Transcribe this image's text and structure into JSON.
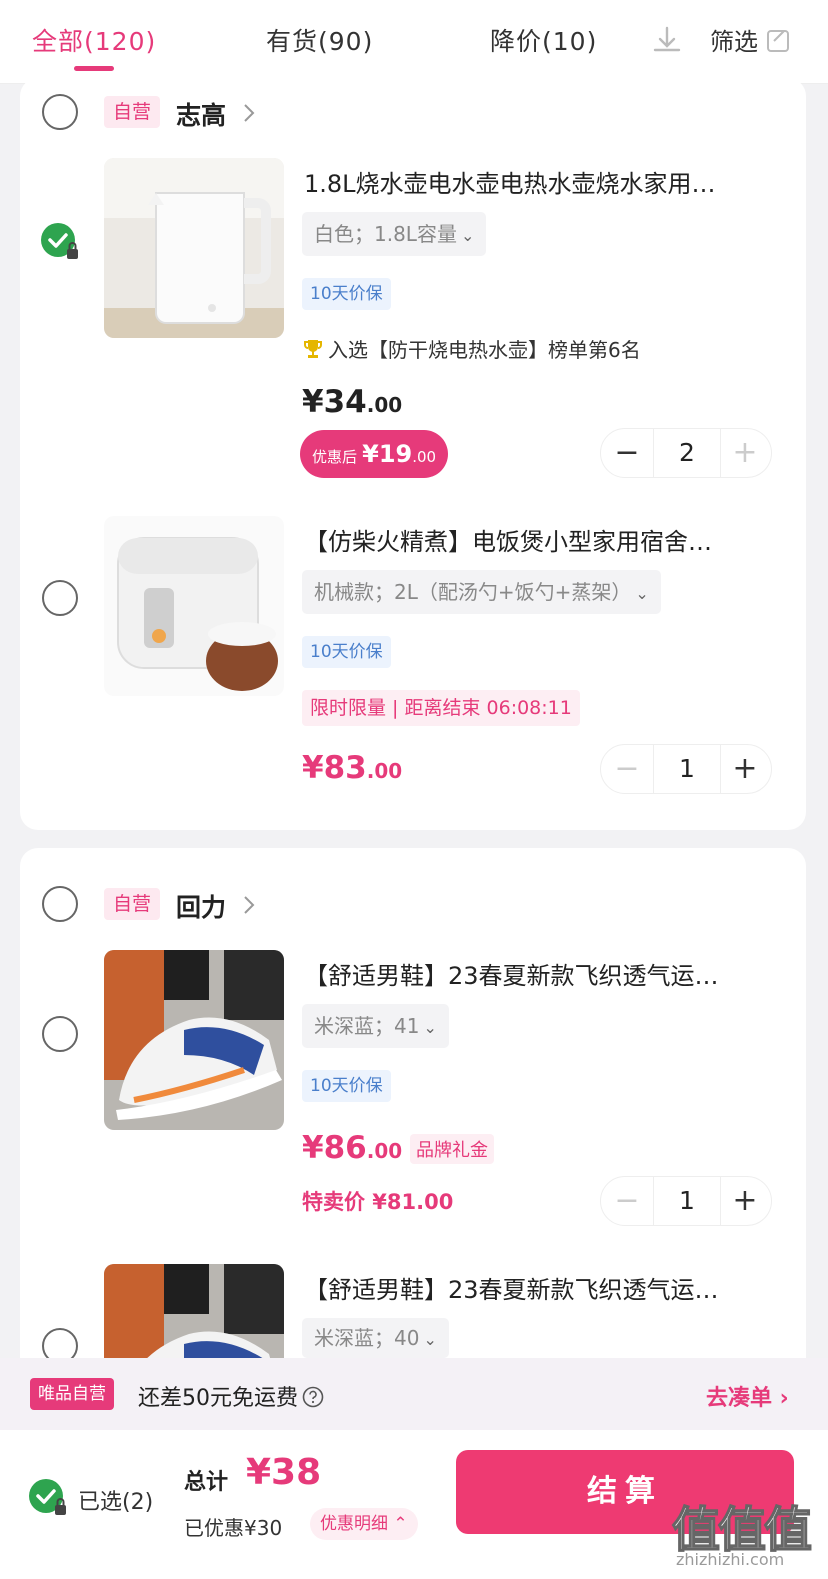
{
  "tabs": [
    {
      "label": "全部(120)",
      "active": true
    },
    {
      "label": "有货(90)",
      "active": false
    },
    {
      "label": "降价(10)",
      "active": false
    }
  ],
  "filter_label": "筛选",
  "icons": [
    "download-icon",
    "filter-icon",
    "chevron-right-icon",
    "check-lock-icon",
    "trophy-icon",
    "help-icon"
  ],
  "colors": {
    "accent": "#e63a7a",
    "checked": "#2ea44f",
    "background": "#f2f2f4"
  },
  "shops": [
    {
      "tag": "自营",
      "name": "志高",
      "items": [
        {
          "selected": true,
          "title": "1.8L烧水壶电水壶电热水壶烧水家用…",
          "spec": "白色；1.8L容量",
          "guarantee": "10天价保",
          "rank": "入选【防干烧电热水壶】榜单第6名",
          "price_symbol": "¥",
          "price_main": "34",
          "price_cents": ".00",
          "discount_prefix": "优惠后",
          "discount_symbol": "¥",
          "discount_main": "19",
          "discount_cents": ".00",
          "quantity": "2",
          "minus": "−",
          "plus": "+"
        },
        {
          "selected": false,
          "title": "【仿柴火精煮】电饭煲小型家用宿舍…",
          "spec": "机械款；2L（配汤勺+饭勺+蒸架）",
          "guarantee": "10天价保",
          "flash": "限时限量 | 距离结束 06:08:11",
          "price_symbol": "¥",
          "price_main": "83",
          "price_cents": ".00",
          "quantity": "1",
          "minus": "−",
          "plus": "+"
        }
      ]
    },
    {
      "tag": "自营",
      "name": "回力",
      "items": [
        {
          "selected": false,
          "title": "【舒适男鞋】23春夏新款飞织透气运…",
          "spec": "米深蓝；41",
          "guarantee": "10天价保",
          "price_symbol": "¥",
          "price_main": "86",
          "price_cents": ".00",
          "brand_gift": "品牌礼金",
          "special_price": "特卖价 ¥81.00",
          "quantity": "1",
          "minus": "−",
          "plus": "+"
        },
        {
          "selected": false,
          "title": "【舒适男鞋】23春夏新款飞织透气运…",
          "spec": "米深蓝；40"
        }
      ]
    }
  ],
  "shipping": {
    "tag": "唯品自营",
    "text": "还差50元免运费",
    "link": "去凑单 ›"
  },
  "footer": {
    "selected": "已选(2)",
    "total_label": "总计",
    "total_value": "¥38",
    "saved": "已优惠¥30",
    "detail": "优惠明细 ⌃",
    "checkout": "结算"
  },
  "watermark": {
    "main": "值值值",
    "sub": "zhizhizhi.com"
  }
}
